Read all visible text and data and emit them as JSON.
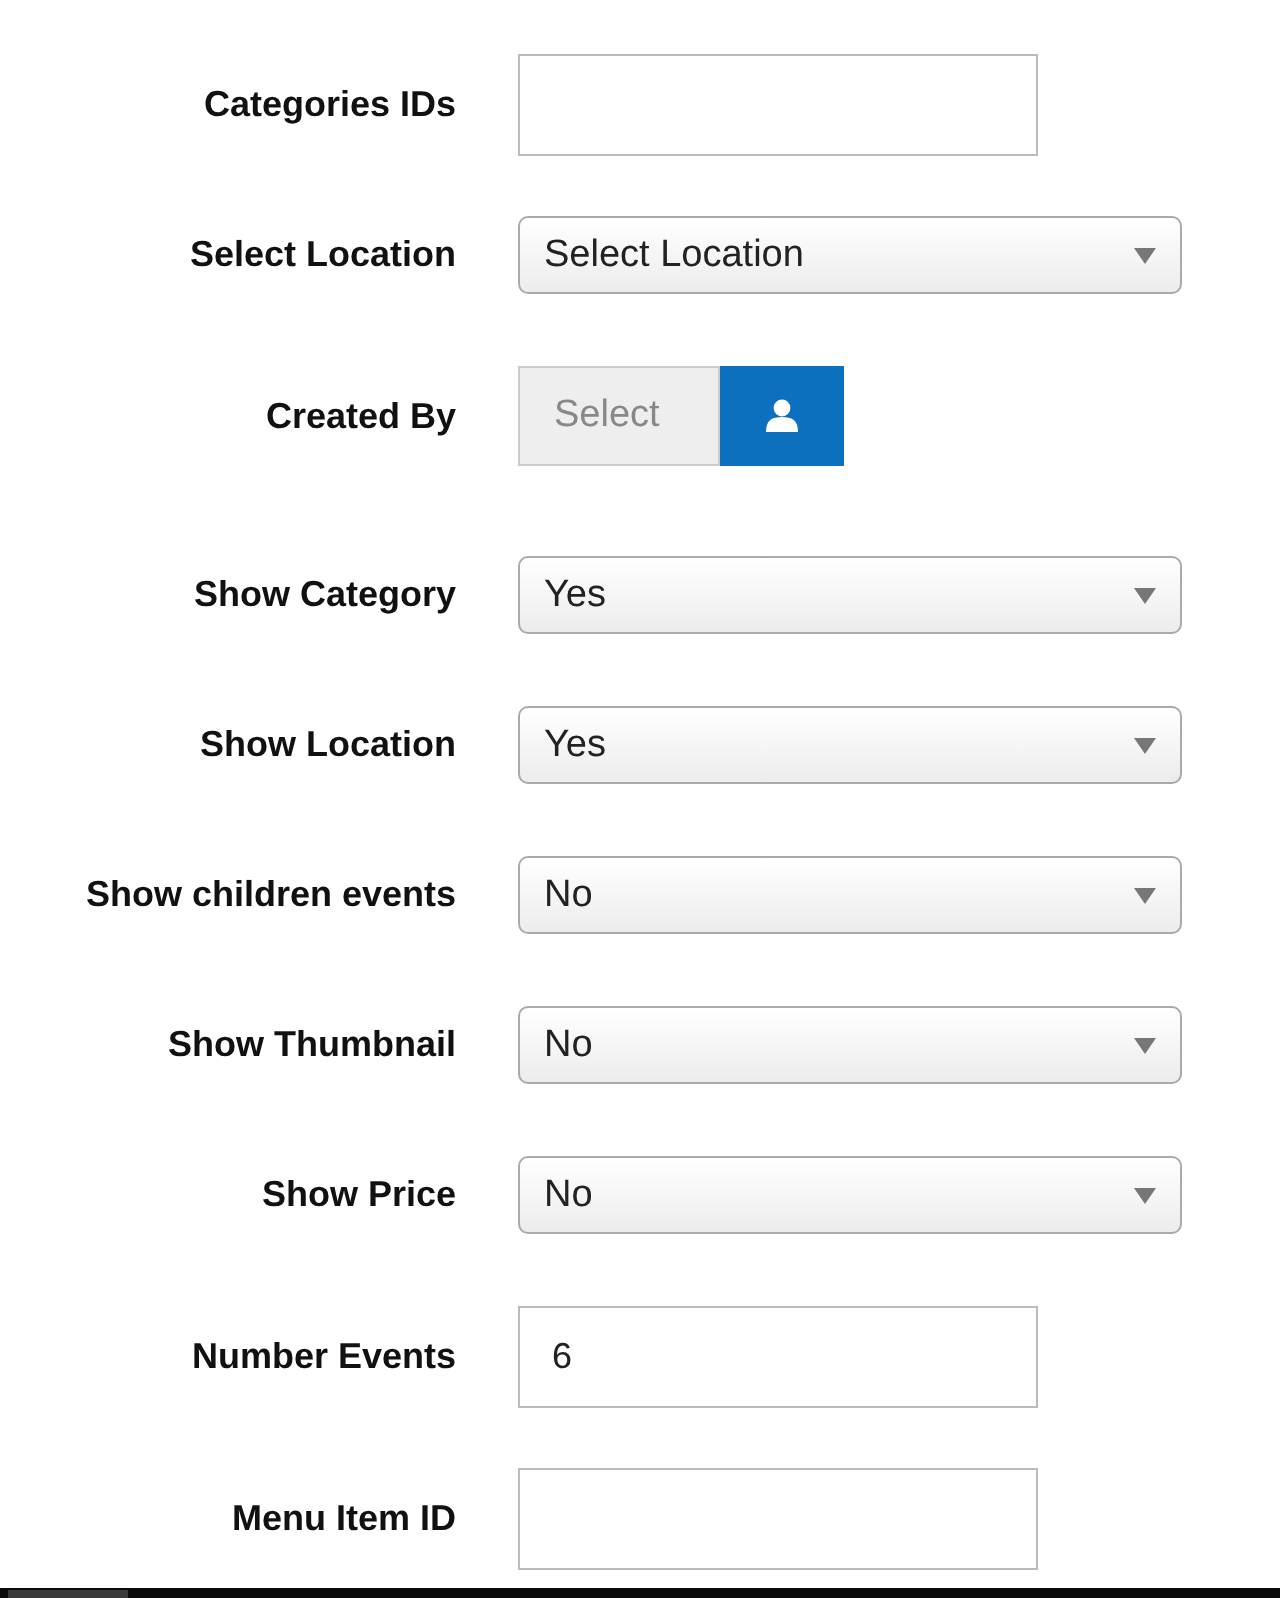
{
  "fields": [
    {
      "kind": "text",
      "label": "Categories IDs"
    },
    {
      "kind": "select",
      "label": "Select Location",
      "value": "Select Location"
    },
    {
      "kind": "user-picker",
      "label": "Created By",
      "placeholder": "Select"
    },
    {
      "kind": "select",
      "label": "Show Category",
      "value": "Yes"
    },
    {
      "kind": "select",
      "label": "Show Location",
      "value": "Yes"
    },
    {
      "kind": "select",
      "label": "Show children events",
      "value": "No"
    },
    {
      "kind": "select",
      "label": "Show Thumbnail",
      "value": "No"
    },
    {
      "kind": "select",
      "label": "Show Price",
      "value": "No"
    },
    {
      "kind": "text",
      "label": "Number Events",
      "value": "6"
    },
    {
      "kind": "text",
      "label": "Menu Item ID"
    }
  ]
}
